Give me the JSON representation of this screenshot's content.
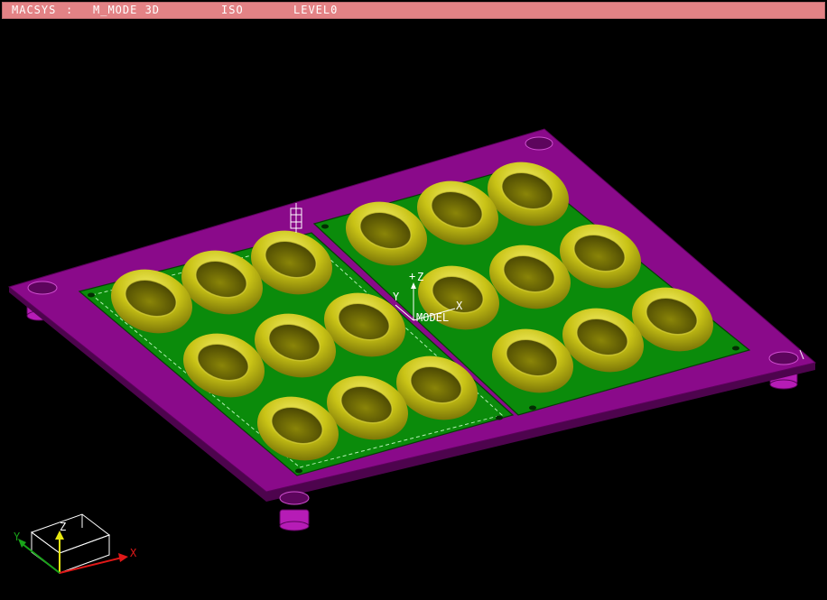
{
  "titlebar": {
    "system": "MACSYS",
    "separator": ":",
    "mode": "M_MODE 3D",
    "view": "ISO",
    "level": "LEVEL0"
  },
  "viewport": {
    "model_label": "MODEL",
    "axis_labels": {
      "x": "X",
      "y": "Y",
      "z": "Z"
    },
    "triad_labels": {
      "x": "X",
      "y": "Y",
      "z": "Z"
    }
  },
  "colors": {
    "background": "#000000",
    "titlebar": "#e38285",
    "base_plate": "#8a0a8a",
    "inner_plate": "#0b8b0b",
    "cavity_shell": "#c9c316",
    "triad_x": "#e01818",
    "triad_y": "#19a319",
    "triad_z": "#e8e810"
  }
}
